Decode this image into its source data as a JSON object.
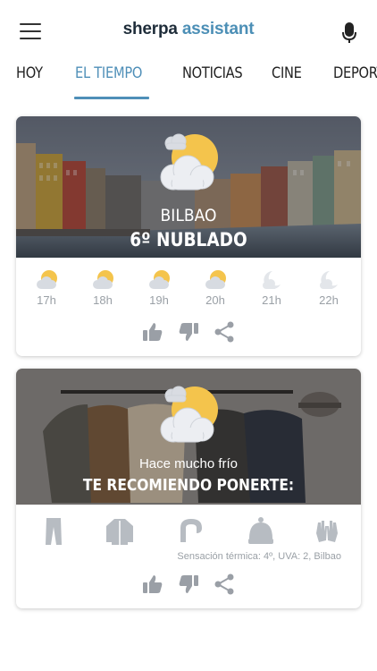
{
  "header": {
    "logo_part1": "sherpa",
    "logo_part2": "assistant",
    "menu_icon": "hamburger-menu-icon",
    "mic_icon": "microphone-icon"
  },
  "tabs": [
    "HOY",
    "EL TIEMPO",
    "NOTICIAS",
    "CINE",
    "DEPORTES"
  ],
  "active_tab": "EL TIEMPO",
  "weather_card": {
    "city": "BILBAO",
    "condition": "6º NUBLADO",
    "icon": "partly-cloudy-icon",
    "hourly": [
      {
        "hour": "17h",
        "icon": "partly-cloudy-icon"
      },
      {
        "hour": "18h",
        "icon": "partly-cloudy-icon"
      },
      {
        "hour": "19h",
        "icon": "partly-cloudy-icon"
      },
      {
        "hour": "20h",
        "icon": "partly-cloudy-icon"
      },
      {
        "hour": "21h",
        "icon": "moon-cloud-icon"
      },
      {
        "hour": "22h",
        "icon": "moon-cloud-icon"
      }
    ]
  },
  "clothing_card": {
    "line1": "Hace mucho frío",
    "line2": "TE RECOMIENDO PONERTE:",
    "items": [
      "trousers-icon",
      "jacket-icon",
      "scarf-icon",
      "beanie-icon",
      "gloves-icon"
    ],
    "feels_like": "Sensación térmica: 4º, UVA: 2, Bilbao"
  },
  "actions": [
    "thumbs-up-icon",
    "thumbs-down-icon",
    "share-icon"
  ],
  "colors": {
    "accent": "#4f8fb8",
    "logo_dark": "#1f2d3a",
    "icon_grey": "#b7bcc2",
    "sun": "#f2c24a"
  }
}
